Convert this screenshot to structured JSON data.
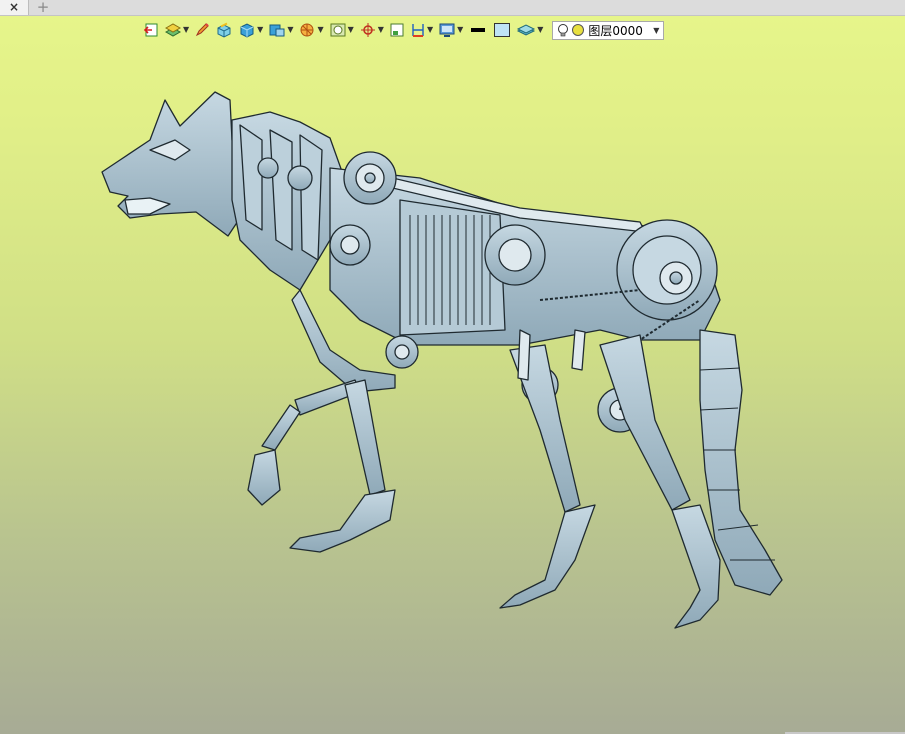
{
  "tabs": {
    "close_glyph": "×",
    "add_glyph": "+"
  },
  "toolbar": {
    "buttons": [
      {
        "icon": "exit-sketch-icon"
      },
      {
        "icon": "layer-stack-icon",
        "dropdown": true
      },
      {
        "icon": "pencil-icon"
      },
      {
        "icon": "box-solid-icon"
      },
      {
        "icon": "shaded-cube-icon",
        "dropdown": true
      },
      {
        "icon": "view-orientation-icon",
        "dropdown": true
      },
      {
        "icon": "section-view-icon",
        "dropdown": true
      },
      {
        "icon": "render-style-icon",
        "dropdown": true
      },
      {
        "icon": "snap-point-icon",
        "dropdown": true
      },
      {
        "icon": "work-plane-icon"
      },
      {
        "icon": "dimension-icon",
        "dropdown": true
      },
      {
        "icon": "display-monitor-icon",
        "dropdown": true
      },
      {
        "icon": "line-color-icon"
      },
      {
        "icon": "fill-color-icon"
      },
      {
        "icon": "layer-manager-icon",
        "dropdown": true
      }
    ],
    "layer": {
      "value": "图层0000"
    }
  },
  "colors": {
    "bg_top": "#e6f58a",
    "bg_bottom": "#a7ab95",
    "model_fill": "#a9c1cf",
    "model_stroke": "#1f2a30"
  }
}
